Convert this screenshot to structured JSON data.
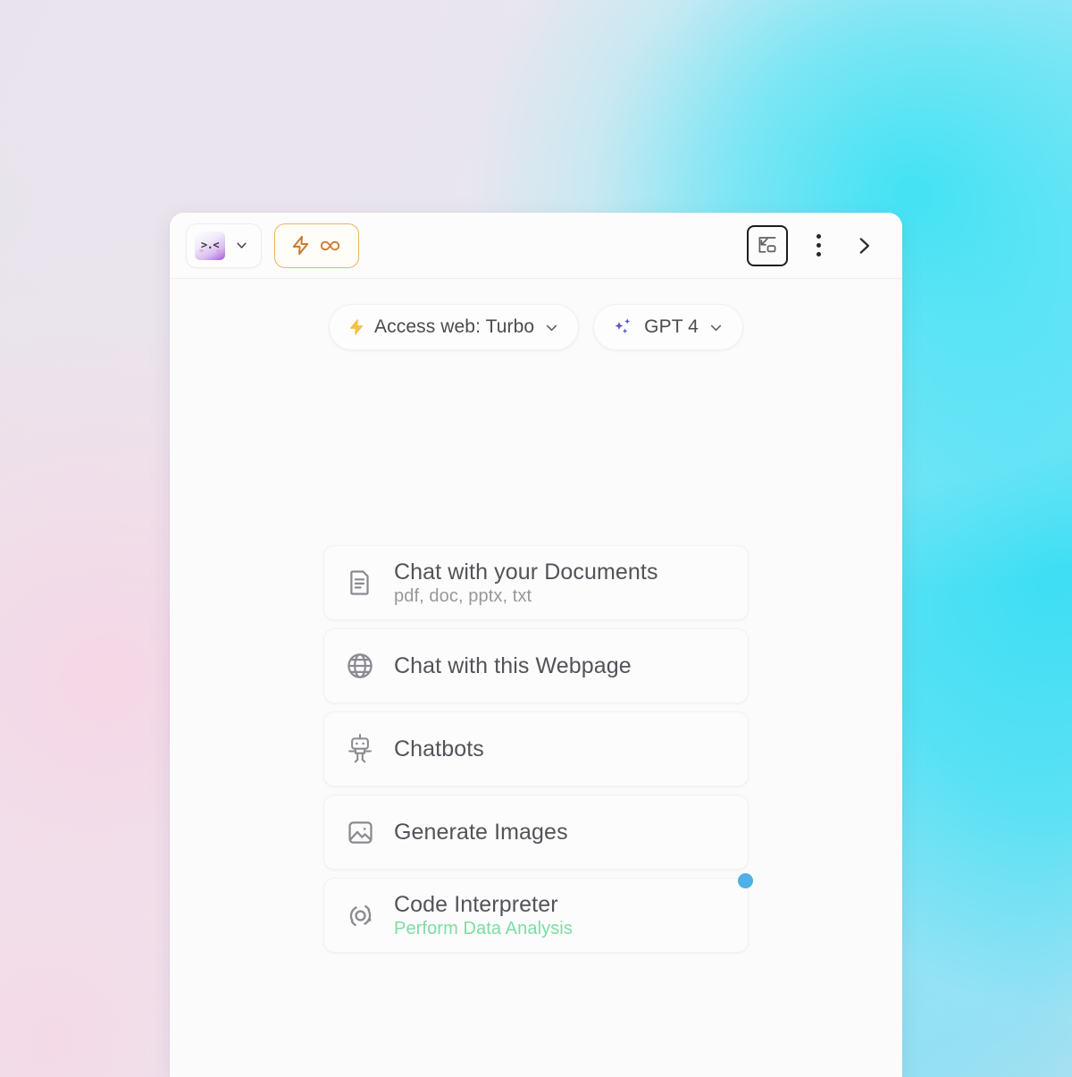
{
  "colors": {
    "accent_orange": "#e8b55f",
    "accent_orange_icon": "#c87a2e",
    "accent_yellow_bolt": "#f5c542",
    "accent_purple": "#5b52d4",
    "accent_green": "#7ddca4",
    "badge_blue": "#4fb0e6",
    "panel_bg": "#fbfbfb",
    "text_primary": "#53535a",
    "text_secondary": "#97979e"
  },
  "header": {
    "avatar_chip": {
      "name": "avatar-selector",
      "face": ">.<",
      "chevron_icon": "chevron-down-icon"
    },
    "turbo_chip": {
      "bolt_icon": "lightning-bolt-icon",
      "infinity_icon": "infinity-icon",
      "infinity_glyph": "∞"
    },
    "actions": [
      {
        "icon": "picture-in-picture-icon",
        "name": "pip-button"
      },
      {
        "icon": "more-vertical-icon",
        "name": "more-options-button"
      },
      {
        "icon": "chevron-right-icon",
        "name": "collapse-panel-button"
      }
    ]
  },
  "mode_row": {
    "web_access": {
      "icon": "lightning-bolt-icon",
      "label": "Access web: Turbo",
      "chevron_icon": "chevron-down-icon"
    },
    "model": {
      "icon": "sparkles-icon",
      "label": "GPT 4",
      "chevron_icon": "chevron-down-icon"
    }
  },
  "cards": [
    {
      "icon": "document-icon",
      "title": "Chat with your Documents",
      "subtitle": "pdf, doc, pptx, txt",
      "subtitle_accent": false,
      "badge": false
    },
    {
      "icon": "globe-icon",
      "title": "Chat with this Webpage",
      "subtitle": "",
      "subtitle_accent": false,
      "badge": false
    },
    {
      "icon": "robot-icon",
      "title": "Chatbots",
      "subtitle": "",
      "subtitle_accent": false,
      "badge": false
    },
    {
      "icon": "image-icon",
      "title": "Generate Images",
      "subtitle": "",
      "subtitle_accent": false,
      "badge": false
    },
    {
      "icon": "code-interpreter-icon",
      "title": "Code Interpreter",
      "subtitle": "Perform Data Analysis",
      "subtitle_accent": true,
      "badge": true
    }
  ]
}
